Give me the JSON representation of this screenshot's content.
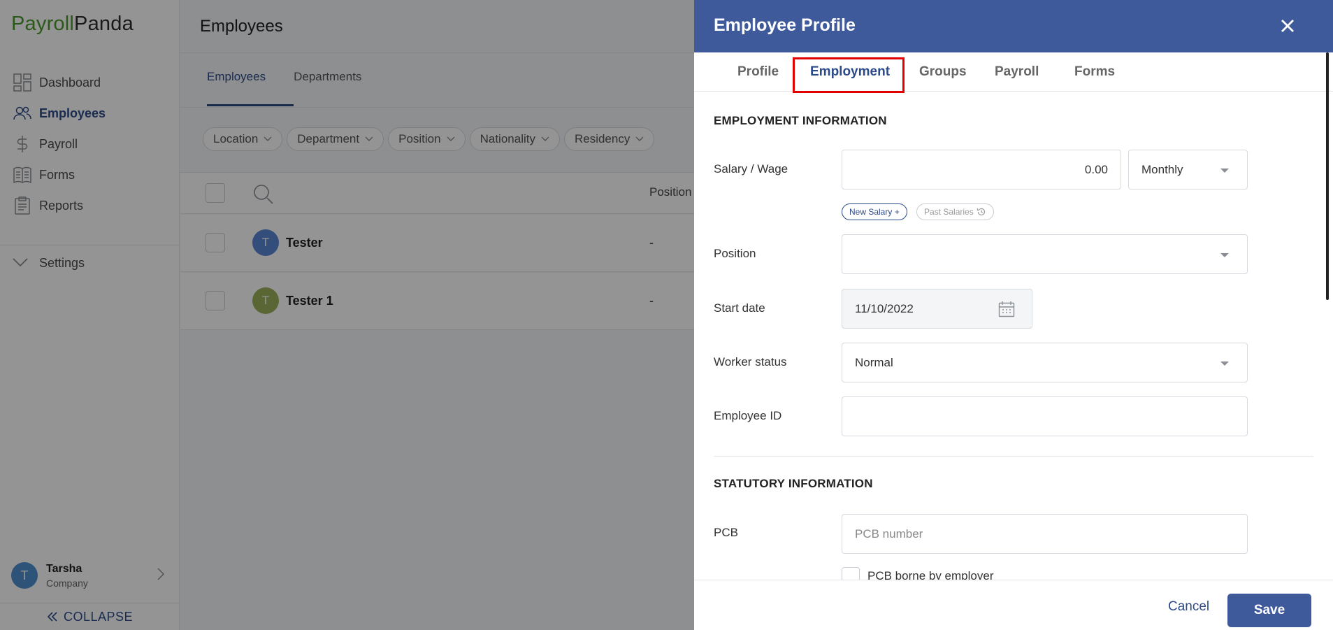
{
  "app": {
    "logo_part1": "Payroll",
    "logo_part2": "Panda"
  },
  "sidebar": {
    "items": [
      {
        "label": "Dashboard",
        "icon": "dashboard-icon"
      },
      {
        "label": "Employees",
        "icon": "users-icon",
        "active": true
      },
      {
        "label": "Payroll",
        "icon": "dollar-icon"
      },
      {
        "label": "Forms",
        "icon": "document-icon"
      },
      {
        "label": "Reports",
        "icon": "clipboard-icon"
      }
    ],
    "settings_label": "Settings",
    "user": {
      "initial": "T",
      "name": "Tarsha",
      "company": "Company"
    },
    "collapse_label": "COLLAPSE"
  },
  "main": {
    "title": "Employees",
    "tabs": [
      "Employees",
      "Departments"
    ],
    "filters": [
      "Location",
      "Department",
      "Position",
      "Nationality",
      "Residency"
    ],
    "columns": {
      "position": "Position"
    },
    "rows": [
      {
        "initial": "T",
        "name": "Tester",
        "position": "-",
        "avatar_color": "#5b87d6"
      },
      {
        "initial": "T",
        "name": "Tester 1",
        "position": "-",
        "avatar_color": "#9bb15a"
      }
    ]
  },
  "drawer": {
    "title": "Employee Profile",
    "tabs": [
      "Profile",
      "Employment",
      "Groups",
      "Payroll",
      "Forms"
    ],
    "active_tab": "Employment",
    "employment_section": "EMPLOYMENT INFORMATION",
    "salary": {
      "label": "Salary / Wage",
      "value": "0.00",
      "frequency": "Monthly",
      "new_salary": "New Salary +",
      "past_salaries": "Past Salaries"
    },
    "position": {
      "label": "Position",
      "value": ""
    },
    "start_date": {
      "label": "Start date",
      "value": "11/10/2022"
    },
    "worker_status": {
      "label": "Worker status",
      "value": "Normal"
    },
    "employee_id": {
      "label": "Employee ID",
      "value": ""
    },
    "statutory_section": "STATUTORY INFORMATION",
    "pcb": {
      "label": "PCB",
      "placeholder": "PCB number",
      "borne_label": "PCB borne by employer"
    },
    "cancel_label": "Cancel",
    "save_label": "Save"
  },
  "colors": {
    "brand_green": "#4a9a2e",
    "primary_blue": "#3f5a9b",
    "highlight_red": "#e30000"
  }
}
